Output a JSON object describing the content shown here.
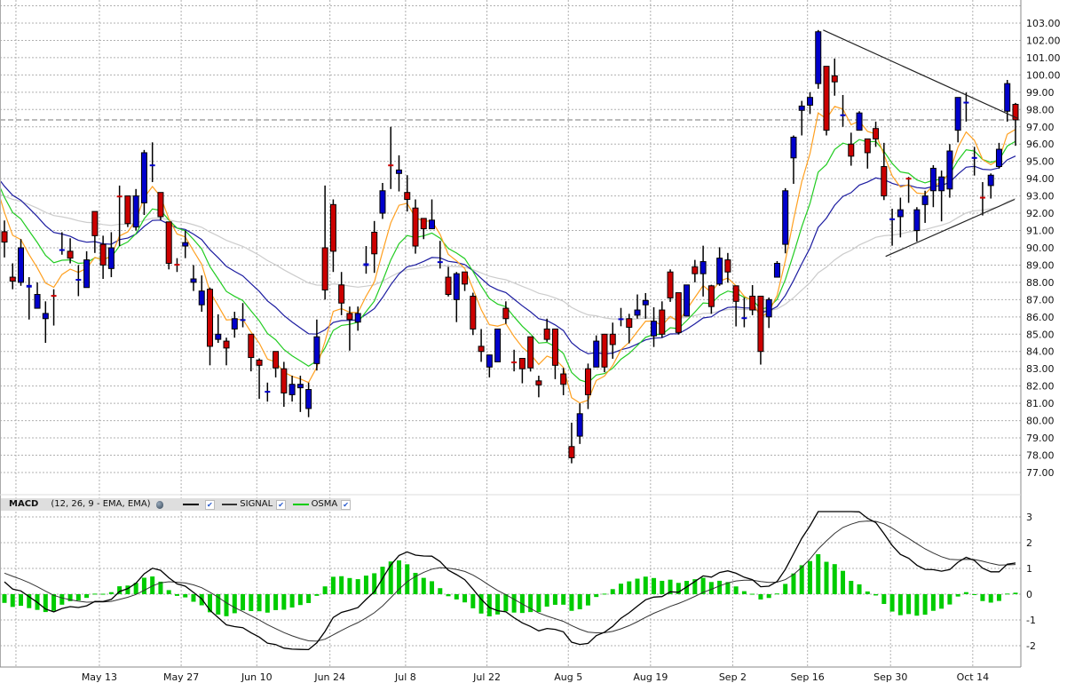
{
  "chart_data": {
    "type": "candlestick",
    "price_axis": {
      "min": 77,
      "max": 103,
      "step": 1,
      "labels": [
        "77.00",
        "78.00",
        "79.00",
        "80.00",
        "81.00",
        "82.00",
        "83.00",
        "84.00",
        "85.00",
        "86.00",
        "87.00",
        "88.00",
        "89.00",
        "90.00",
        "91.00",
        "92.00",
        "93.00",
        "94.00",
        "95.00",
        "96.00",
        "97.00",
        "98.00",
        "99.00",
        "100.00",
        "101.00",
        "102.00",
        "103.00"
      ]
    },
    "last_price": 97.4,
    "date_axis": [
      {
        "label": "",
        "bar": 1.4
      },
      {
        "label": "May 13",
        "bar": 11.55
      },
      {
        "label": "May 27",
        "bar": 21.5
      },
      {
        "label": "Jun 10",
        "bar": 30.7
      },
      {
        "label": "Jun 24",
        "bar": 39.6
      },
      {
        "label": "Jul 8",
        "bar": 48.8
      },
      {
        "label": "Jul 22",
        "bar": 58.7
      },
      {
        "label": "Aug 5",
        "bar": 68.6
      },
      {
        "label": "Aug 19",
        "bar": 78.6
      },
      {
        "label": "Sep 2",
        "bar": 88.6
      },
      {
        "label": "Sep 16",
        "bar": 97.7
      },
      {
        "label": "Sep 30",
        "bar": 107.8
      },
      {
        "label": "Oct 14",
        "bar": 117.8
      }
    ],
    "colors": {
      "up": "#0000cc",
      "down": "#cc0000",
      "osma": "#00cc00",
      "macd": "#000000",
      "signal": "#333333"
    },
    "ohlc": [
      [
        90.93,
        91.58,
        89.44,
        90.33
      ],
      [
        88.3,
        89.1,
        87.6,
        88.07
      ],
      [
        88.0,
        90.5,
        87.8,
        90.0
      ],
      [
        87.7,
        88.3,
        85.85,
        87.85
      ],
      [
        86.5,
        88.0,
        86.5,
        87.3
      ],
      [
        85.9,
        86.9,
        84.5,
        86.2
      ],
      [
        87.27,
        87.6,
        85.5,
        87.23
      ],
      [
        89.88,
        90.9,
        89.6,
        89.92
      ],
      [
        89.8,
        90.55,
        89.1,
        89.4
      ],
      [
        88.1,
        89.0,
        87.2,
        88.2
      ],
      [
        87.7,
        89.8,
        87.7,
        89.3
      ],
      [
        92.1,
        92.1,
        89.7,
        90.7
      ],
      [
        90.2,
        90.7,
        88.2,
        89.0
      ],
      [
        88.8,
        90.9,
        88.3,
        90.0
      ],
      [
        93.02,
        93.6,
        90.1,
        92.98
      ],
      [
        93.0,
        93.0,
        91.2,
        91.4
      ],
      [
        91.2,
        93.4,
        91.0,
        93.0
      ],
      [
        92.6,
        95.66,
        91.9,
        95.5
      ],
      [
        94.78,
        96.1,
        93.8,
        94.82
      ],
      [
        93.2,
        93.2,
        91.6,
        91.8
      ],
      [
        91.5,
        91.5,
        88.75,
        89.1
      ],
      [
        89.07,
        89.4,
        88.6,
        89.03
      ],
      [
        90.1,
        91.0,
        89.4,
        90.3
      ],
      [
        88.0,
        89.0,
        87.5,
        88.2
      ],
      [
        86.7,
        88.4,
        86.3,
        87.5
      ],
      [
        87.6,
        87.7,
        83.2,
        84.3
      ],
      [
        84.7,
        86.15,
        84.5,
        85.0
      ],
      [
        84.6,
        84.8,
        83.2,
        84.2
      ],
      [
        85.3,
        86.3,
        84.8,
        85.9
      ],
      [
        85.83,
        86.8,
        85.4,
        85.87
      ],
      [
        85.0,
        85.0,
        82.85,
        83.65
      ],
      [
        83.5,
        83.6,
        81.26,
        83.2
      ],
      [
        81.68,
        82.2,
        81.1,
        81.72
      ],
      [
        84.0,
        84.0,
        82.5,
        83.05
      ],
      [
        83.0,
        83.4,
        80.8,
        81.6
      ],
      [
        81.5,
        82.6,
        81.1,
        82.1
      ],
      [
        81.9,
        82.6,
        80.5,
        82.1
      ],
      [
        80.7,
        82.2,
        80.2,
        81.8
      ],
      [
        83.3,
        85.85,
        82.9,
        84.85
      ],
      [
        90.0,
        93.6,
        87.0,
        87.56
      ],
      [
        92.5,
        92.8,
        88.6,
        89.8
      ],
      [
        87.85,
        88.6,
        86.1,
        86.8
      ],
      [
        86.2,
        86.6,
        84.05,
        85.85
      ],
      [
        85.7,
        86.6,
        85.2,
        86.2
      ],
      [
        88.95,
        90.1,
        88.5,
        89.1
      ],
      [
        90.9,
        91.55,
        88.55,
        89.65
      ],
      [
        92.0,
        93.75,
        91.67,
        93.3
      ],
      [
        94.82,
        97.0,
        93.4,
        94.78
      ],
      [
        94.3,
        95.35,
        93.26,
        94.5
      ],
      [
        93.2,
        94.2,
        92.1,
        92.8
      ],
      [
        92.3,
        92.8,
        89.66,
        90.1
      ],
      [
        91.7,
        91.7,
        90.5,
        91.1
      ],
      [
        91.1,
        92.8,
        91.1,
        91.6
      ],
      [
        89.18,
        90.4,
        88.8,
        89.22
      ],
      [
        88.3,
        88.9,
        87.18,
        87.3
      ],
      [
        87.0,
        88.6,
        85.7,
        88.5
      ],
      [
        88.6,
        88.6,
        87.5,
        87.9
      ],
      [
        87.2,
        87.4,
        84.95,
        85.3
      ],
      [
        84.3,
        85.3,
        83.4,
        84.0
      ],
      [
        83.1,
        83.8,
        82.5,
        83.8
      ],
      [
        83.4,
        85.3,
        83.4,
        85.3
      ],
      [
        86.5,
        86.9,
        85.6,
        85.9
      ],
      [
        83.42,
        84.1,
        82.85,
        83.38
      ],
      [
        83.6,
        83.6,
        82.16,
        83.0
      ],
      [
        84.85,
        84.85,
        82.84,
        83.05
      ],
      [
        82.3,
        82.6,
        81.35,
        82.07
      ],
      [
        85.3,
        85.9,
        84.56,
        84.7
      ],
      [
        85.3,
        85.3,
        82.4,
        83.2
      ],
      [
        82.7,
        83.05,
        81.47,
        82.1
      ],
      [
        78.5,
        79.88,
        77.53,
        77.85
      ],
      [
        79.1,
        81.0,
        78.65,
        80.4
      ],
      [
        83.0,
        83.3,
        80.67,
        81.5
      ],
      [
        83.1,
        84.93,
        83.1,
        84.6
      ],
      [
        85.0,
        85.0,
        82.8,
        83.1
      ],
      [
        85.0,
        85.67,
        83.58,
        84.4
      ],
      [
        85.88,
        86.52,
        85.46,
        85.92
      ],
      [
        85.9,
        86.18,
        84.47,
        85.4
      ],
      [
        86.1,
        87.3,
        85.9,
        86.4
      ],
      [
        86.7,
        87.38,
        85.9,
        86.95
      ],
      [
        84.9,
        86.56,
        84.26,
        85.75
      ],
      [
        86.4,
        86.9,
        84.8,
        85.0
      ],
      [
        88.6,
        88.75,
        86.87,
        87.1
      ],
      [
        87.4,
        87.4,
        84.98,
        85.1
      ],
      [
        86.05,
        87.85,
        86.05,
        87.85
      ],
      [
        88.9,
        89.3,
        88.0,
        88.5
      ],
      [
        88.5,
        90.12,
        87.18,
        89.2
      ],
      [
        87.8,
        87.86,
        86.18,
        86.6
      ],
      [
        87.9,
        90.03,
        87.8,
        89.4
      ],
      [
        89.3,
        89.7,
        87.98,
        88.6
      ],
      [
        87.8,
        87.8,
        85.45,
        86.9
      ],
      [
        85.88,
        87.12,
        85.4,
        85.98
      ],
      [
        87.2,
        87.84,
        86.1,
        86.4
      ],
      [
        87.2,
        87.2,
        83.24,
        84.0
      ],
      [
        86.0,
        87.12,
        85.36,
        87.0
      ],
      [
        88.3,
        89.23,
        88.3,
        89.1
      ],
      [
        90.2,
        93.45,
        89.68,
        93.3
      ],
      [
        95.2,
        96.5,
        93.7,
        96.4
      ],
      [
        97.95,
        98.5,
        96.5,
        98.2
      ],
      [
        98.25,
        99.0,
        97.74,
        98.7
      ],
      [
        99.5,
        102.6,
        99.2,
        102.5
      ],
      [
        100.5,
        100.5,
        96.5,
        96.8
      ],
      [
        99.95,
        100.95,
        98.8,
        99.6
      ],
      [
        97.68,
        98.84,
        97.0,
        97.72
      ],
      [
        96.0,
        96.66,
        94.75,
        95.3
      ],
      [
        96.8,
        97.9,
        96.8,
        97.8
      ],
      [
        96.3,
        96.3,
        94.58,
        95.5
      ],
      [
        96.9,
        97.3,
        95.84,
        96.3
      ],
      [
        94.7,
        96.07,
        92.76,
        93.0
      ],
      [
        91.6,
        92.26,
        90.12,
        91.7
      ],
      [
        91.8,
        92.9,
        90.6,
        92.2
      ],
      [
        94.05,
        94.1,
        92.6,
        93.95
      ],
      [
        91.0,
        92.35,
        90.36,
        92.2
      ],
      [
        92.5,
        93.3,
        91.44,
        93.0
      ],
      [
        93.3,
        94.78,
        92.35,
        94.6
      ],
      [
        93.3,
        94.47,
        91.53,
        94.1
      ],
      [
        93.4,
        96.0,
        92.9,
        95.6
      ],
      [
        96.8,
        98.7,
        96.1,
        98.7
      ],
      [
        98.4,
        98.98,
        97.3,
        98.45
      ],
      [
        95.2,
        95.84,
        94.18,
        95.25
      ],
      [
        92.95,
        93.8,
        91.87,
        92.9
      ],
      [
        93.6,
        94.3,
        92.85,
        94.2
      ],
      [
        94.7,
        96.07,
        94.58,
        95.7
      ],
      [
        97.9,
        99.71,
        97.3,
        99.5
      ],
      [
        98.3,
        98.38,
        95.9,
        97.4
      ]
    ],
    "overlays": [
      {
        "type": "ema",
        "period": 50,
        "seed": 93.1,
        "color": "#cccccc"
      },
      {
        "type": "ema",
        "period": 20,
        "seed": 93.9,
        "color": "#1c1ca0"
      },
      {
        "type": "ema",
        "period": 10,
        "seed": 93.5,
        "color": "#22cc22"
      },
      {
        "type": "ema",
        "period": 5,
        "seed": 92.9,
        "color": "#ffa020"
      }
    ],
    "trendlines": [
      {
        "from": [
          99.6,
          102.6
        ],
        "to": [
          123.2,
          97.5
        ]
      },
      {
        "from": [
          107.2,
          89.5
        ],
        "to": [
          122.9,
          92.8
        ]
      }
    ],
    "macd": {
      "title": "MACD",
      "params": "(12, 26, 9 - EMA, EMA)",
      "fast": 12,
      "slow": 26,
      "signal": 9,
      "seed_fast": 91.3,
      "seed_slow": 90.7,
      "seed_signal": 0.9,
      "legend": [
        {
          "label": "",
          "color": "#000000",
          "checked": true
        },
        {
          "label": "SIGNAL",
          "color": "#333333",
          "checked": true
        },
        {
          "label": "OSMA",
          "color": "#00cc00",
          "checked": true
        }
      ],
      "axis": {
        "min": -2,
        "max": 3,
        "labels": [
          "-2",
          "-1",
          "0",
          "1",
          "2",
          "3"
        ]
      }
    }
  }
}
